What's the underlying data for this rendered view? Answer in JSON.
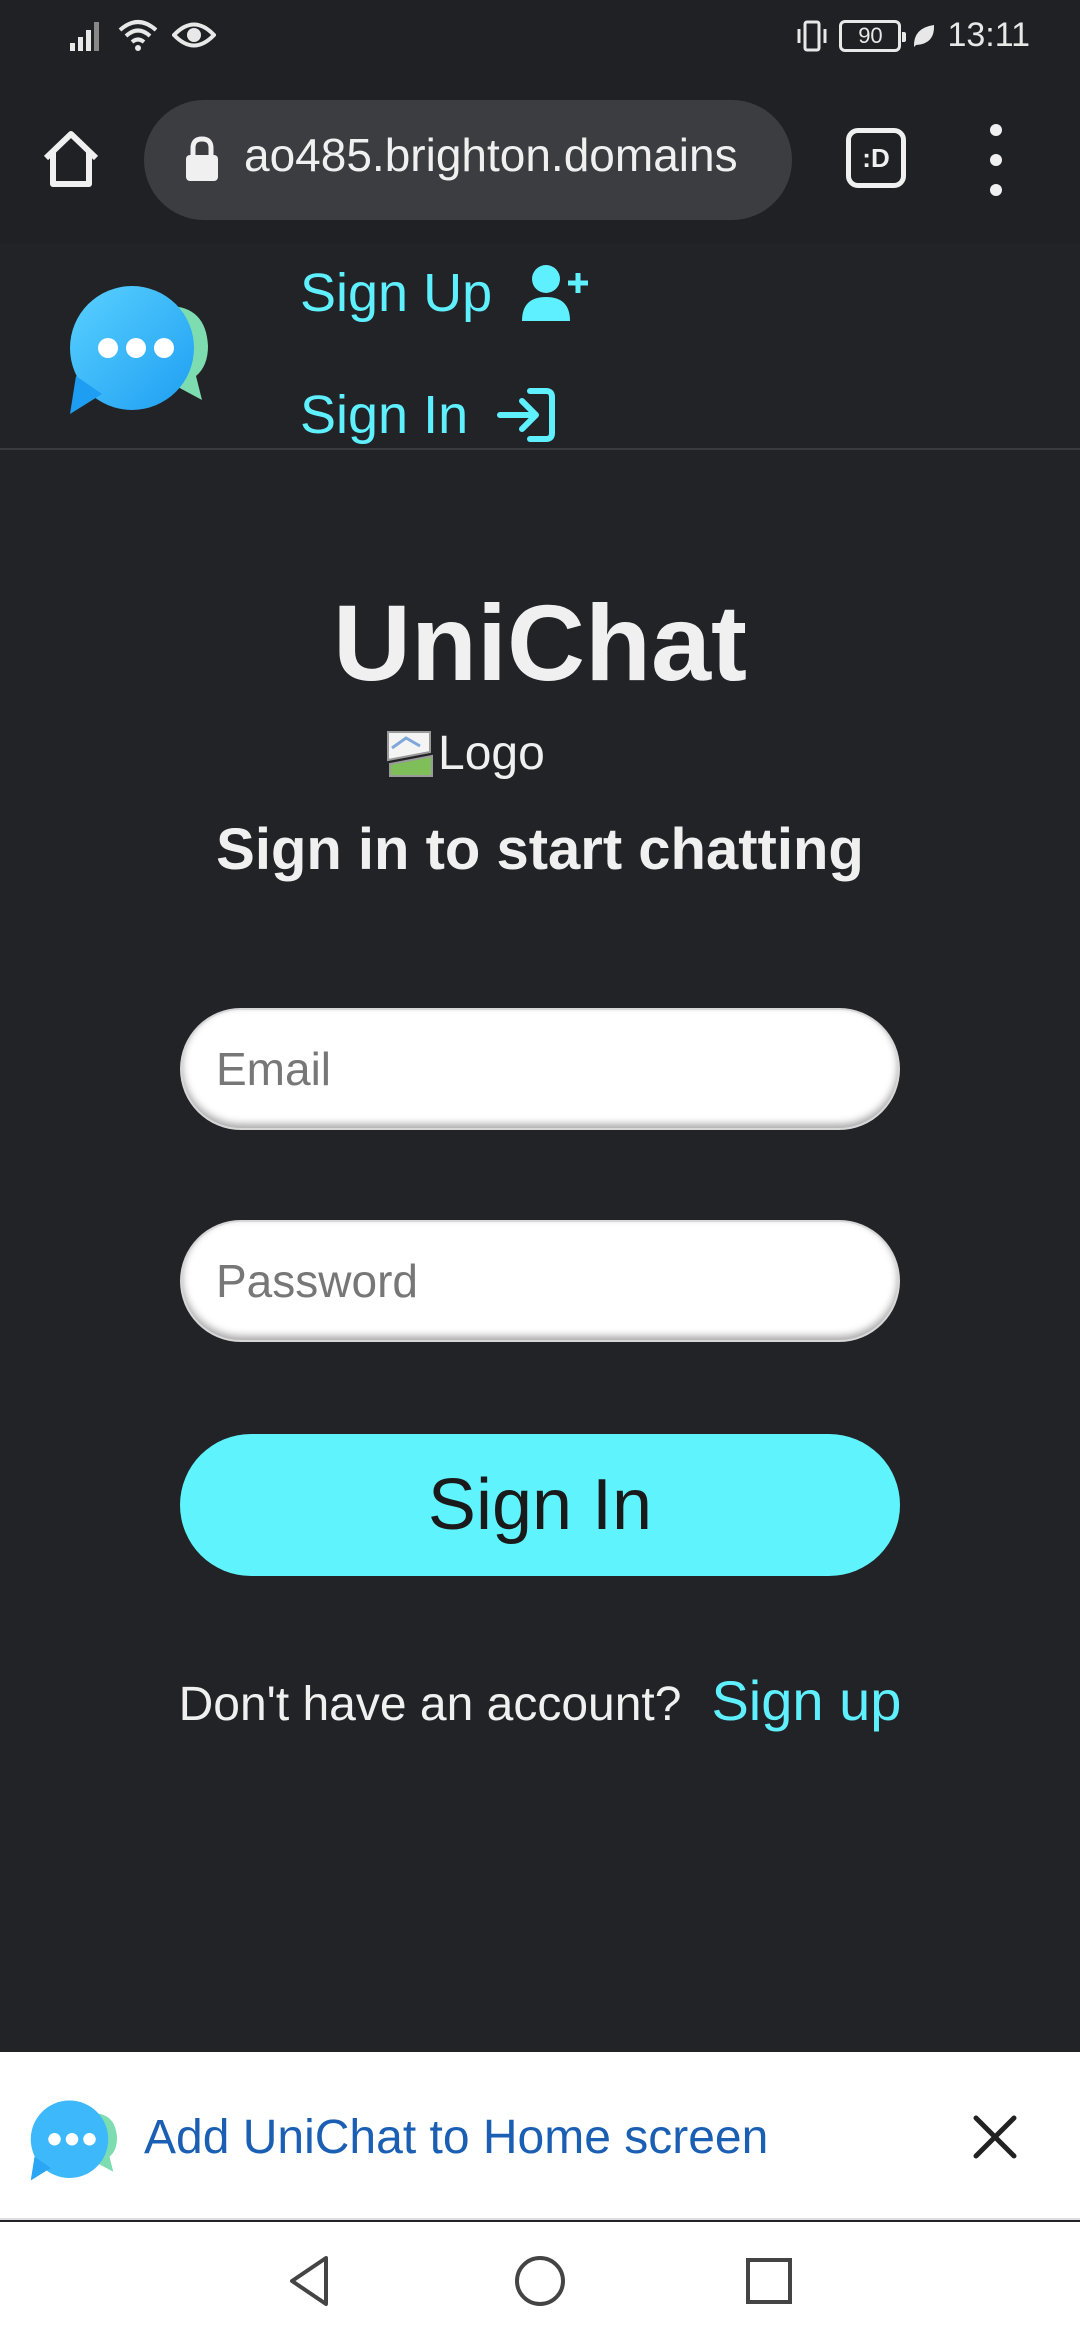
{
  "status_bar": {
    "battery": "90",
    "time": "13:11"
  },
  "browser": {
    "url": "ao485.brighton.domains",
    "tabs_label": ":D"
  },
  "site_header": {
    "nav": {
      "signup": "Sign Up",
      "signin": "Sign In"
    }
  },
  "main": {
    "title": "UniChat",
    "logo_alt": "Logo",
    "subtitle": "Sign in to start chatting",
    "email_placeholder": "Email",
    "password_placeholder": "Password",
    "signin_button": "Sign In",
    "no_account_text": "Don't have an account?",
    "signup_link": "Sign up"
  },
  "a2hs_banner": {
    "text": "Add UniChat to Home screen"
  },
  "colors": {
    "accent": "#5ef3fd",
    "background": "#222326",
    "link_blue": "#1a5fb4"
  },
  "icons": {
    "home": "home-icon",
    "lock": "lock-icon",
    "menu": "more-vert-icon",
    "add_user": "person-add-icon",
    "sign_in": "login-arrow-icon",
    "close": "close-icon"
  }
}
